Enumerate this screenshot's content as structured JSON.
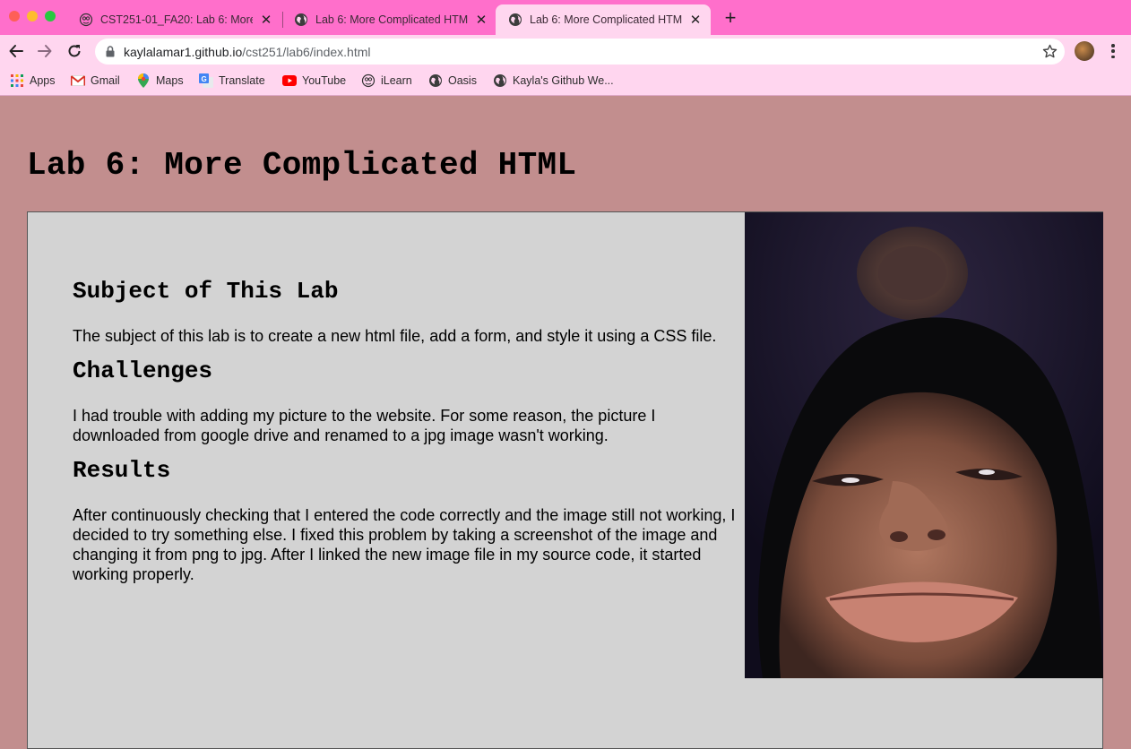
{
  "browser": {
    "tabs": [
      {
        "title": "CST251-01_FA20: Lab 6: More Complicated HTML",
        "icon": "ilearn-icon",
        "active": false
      },
      {
        "title": "Lab 6: More Complicated HTML",
        "icon": "globe-icon",
        "active": false
      },
      {
        "title": "Lab 6: More Complicated HTML",
        "icon": "globe-icon",
        "active": true
      }
    ],
    "close_glyph": "✕",
    "new_tab_glyph": "+",
    "url_host": "kaylalamar1.github.io",
    "url_path": "/cst251/lab6/index.html",
    "bookmarks": [
      {
        "label": "Apps",
        "icon": "apps-grid-icon"
      },
      {
        "label": "Gmail",
        "icon": "gmail-icon"
      },
      {
        "label": "Maps",
        "icon": "maps-icon"
      },
      {
        "label": "Translate",
        "icon": "translate-icon"
      },
      {
        "label": "YouTube",
        "icon": "youtube-icon"
      },
      {
        "label": "iLearn",
        "icon": "ilearn-icon"
      },
      {
        "label": "Oasis",
        "icon": "globe-icon"
      },
      {
        "label": "Kayla's Github We...",
        "icon": "globe-icon"
      }
    ],
    "colors": {
      "tab_bar": "#ff6fcb",
      "toolbar": "#ffd6ef",
      "page_background": "#c28e8e",
      "content_background": "#d3d3d3"
    }
  },
  "page": {
    "title": "Lab 6: More Complicated HTML",
    "sections": [
      {
        "heading": "Subject of This Lab",
        "body": "The subject of this lab is to create a new html file, add a form, and style it using a CSS file."
      },
      {
        "heading": "Challenges",
        "body": "I had trouble with adding my picture to the website. For some reason, the picture I downloaded from google drive and renamed to a jpg image wasn't working."
      },
      {
        "heading": "Results",
        "body": "After continuously checking that I entered the code correctly and the image still not working, I decided to try something else. I fixed this problem by taking a screenshot of the image and changing it from png to jpg. After I linked the new image file in my source code, it started working properly."
      }
    ]
  }
}
